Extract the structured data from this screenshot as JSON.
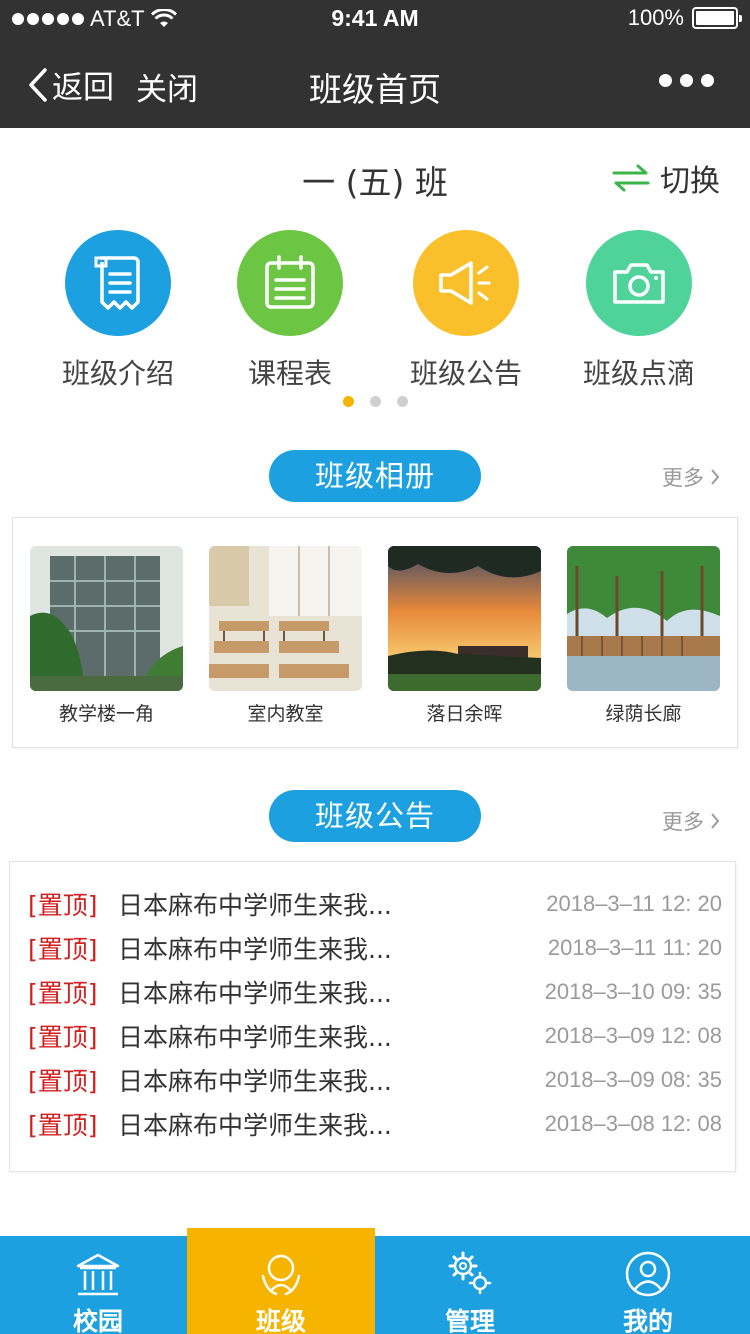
{
  "status_bar": {
    "carrier": "AT&T",
    "time": "9:41 AM",
    "battery": "100%"
  },
  "nav": {
    "back_label": "返回",
    "close_label": "关闭",
    "title": "班级首页"
  },
  "class_header": {
    "name": "一 (五) 班",
    "switch_label": "切换"
  },
  "functions": [
    {
      "label": "班级介绍",
      "icon": "scroll-icon",
      "color": "#1da0e0"
    },
    {
      "label": "课程表",
      "icon": "calendar-icon",
      "color": "#6cc644"
    },
    {
      "label": "班级公告",
      "icon": "megaphone-icon",
      "color": "#f9c02b"
    },
    {
      "label": "班级点滴",
      "icon": "camera-icon",
      "color": "#4fd39a"
    }
  ],
  "pager": {
    "pages": 3,
    "active_index": 0
  },
  "album": {
    "title": "班级相册",
    "more_label": "更多",
    "photos": [
      {
        "caption": "教学楼一角"
      },
      {
        "caption": "室内教室"
      },
      {
        "caption": "落日余晖"
      },
      {
        "caption": "绿荫长廊"
      }
    ]
  },
  "notices": {
    "title": "班级公告",
    "more_label": "更多",
    "items": [
      {
        "tag": "[置顶]",
        "text": "日本麻布中学师生来我...",
        "date": "2018–3–11   12: 20"
      },
      {
        "tag": "[置顶]",
        "text": "日本麻布中学师生来我...",
        "date": "2018–3–11   11: 20"
      },
      {
        "tag": "[置顶]",
        "text": "日本麻布中学师生来我...",
        "date": "2018–3–10   09: 35"
      },
      {
        "tag": "[置顶]",
        "text": "日本麻布中学师生来我...",
        "date": "2018–3–09   12: 08"
      },
      {
        "tag": "[置顶]",
        "text": "日本麻布中学师生来我...",
        "date": "2018–3–09   08: 35"
      },
      {
        "tag": "[置顶]",
        "text": "日本麻布中学师生来我...",
        "date": "2018–3–08   12: 08"
      }
    ]
  },
  "tabbar": {
    "items": [
      {
        "label": "校园",
        "icon": "campus-icon"
      },
      {
        "label": "班级",
        "icon": "class-icon",
        "active": true
      },
      {
        "label": "管理",
        "icon": "gears-icon"
      },
      {
        "label": "我的",
        "icon": "profile-icon"
      }
    ]
  },
  "colors": {
    "brand_blue": "#1da0e0",
    "active_tab": "#f6b400",
    "pin_red": "#d21e1e",
    "nav_dark": "#323233"
  }
}
